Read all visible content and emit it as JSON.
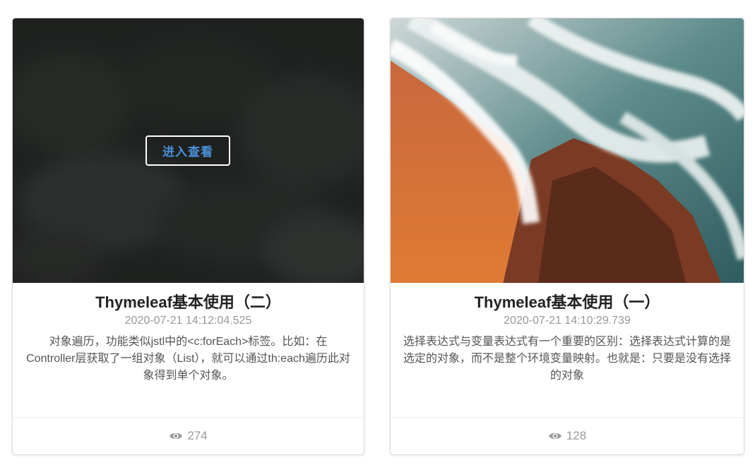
{
  "cards": [
    {
      "overlay_button": "进入查看",
      "title": "Thymeleaf基本使用（二）",
      "date": "2020-07-21 14:12:04.525",
      "description": "对象遍历，功能类似jstl中的<c:forEach>标签。比如：在Controller层获取了一组对象（List），就可以通过th:each遍历此对象得到单个对象。",
      "views": "274",
      "views_icon": "eye-icon"
    },
    {
      "title": "Thymeleaf基本使用（一）",
      "date": "2020-07-21 14:10:29.739",
      "description": "选择表达式与变量表达式有一个重要的区别：选择表达式计算的是选定的对象，而不是整个环境变量映射。也就是：只要是没有选择的对象",
      "views": "128",
      "views_icon": "eye-icon"
    }
  ],
  "colors": {
    "button_text": "#4a90d9",
    "overlay": "#1a1c1c"
  }
}
